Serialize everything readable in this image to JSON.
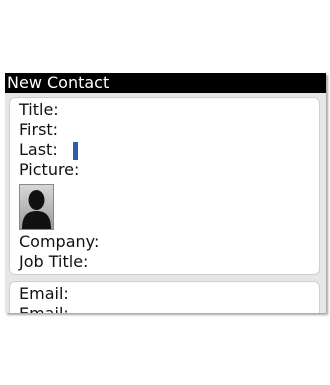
{
  "header": {
    "title": "New Contact"
  },
  "form": {
    "title_label": "Title:",
    "first_label": "First:",
    "last_label": "Last:",
    "picture_label": "Picture:",
    "company_label": "Company:",
    "job_title_label": "Job Title:",
    "email_label": "Email:",
    "email2_label": "Email:"
  },
  "icons": {
    "picture": "contact-silhouette-icon"
  },
  "colors": {
    "cursor": "#2a5ea8",
    "title_bar": "#000000"
  }
}
